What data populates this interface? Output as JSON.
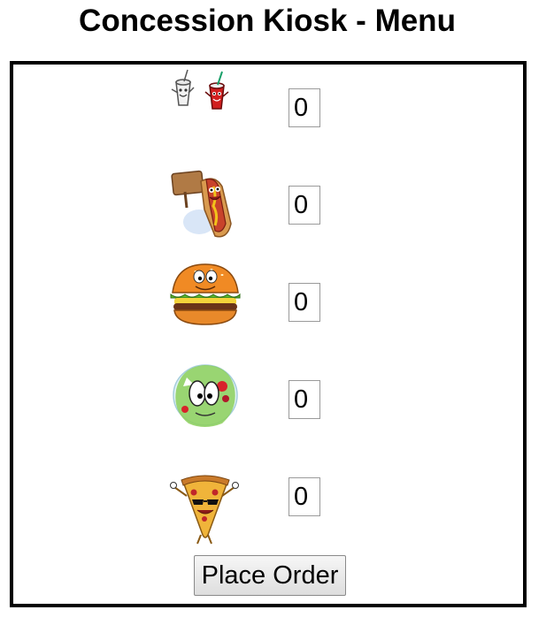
{
  "page": {
    "title": "Concession Kiosk - Menu"
  },
  "menu": {
    "items": [
      {
        "icon": "soda-cups-icon",
        "quantity": "0"
      },
      {
        "icon": "hot-dog-icon",
        "quantity": "0"
      },
      {
        "icon": "burger-icon",
        "quantity": "0"
      },
      {
        "icon": "salad-icon",
        "quantity": "0"
      },
      {
        "icon": "pizza-slice-icon",
        "quantity": "0"
      }
    ],
    "order_button_label": "Place Order"
  },
  "colors": {
    "border": "#000000",
    "input_border": "#9a9a9a",
    "button_bg": "#e6e6e6"
  }
}
